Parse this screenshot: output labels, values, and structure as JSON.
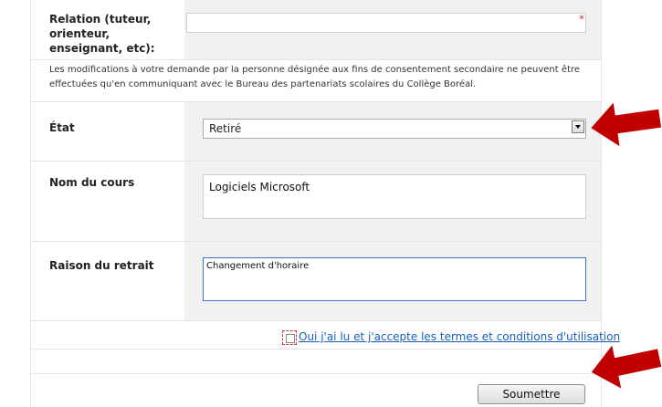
{
  "relation": {
    "label": "Relation (tuteur, orienteur, enseignant, etc):",
    "value": "",
    "required_mark": "*"
  },
  "notice": "Les modifications à votre demande par la personne désignée aux fins de consentement secondaire ne peuvent être effectuées qu'en communiquant avec le Bureau des partenariats scolaires du Collège Boréal.",
  "etat": {
    "label": "État",
    "selected": "Retiré"
  },
  "cours": {
    "label": "Nom du cours",
    "value": "Logiciels Microsoft"
  },
  "raison": {
    "label": "Raison du retrait",
    "value": "Changement d'horaire"
  },
  "terms_label": "Oui j'ai lu et j'accepte les termes et conditions d'utilisation",
  "submit_label": "Soumettre",
  "colors": {
    "arrow": "#c00000",
    "link": "#1a5fb4",
    "focus": "#3a72c8"
  }
}
